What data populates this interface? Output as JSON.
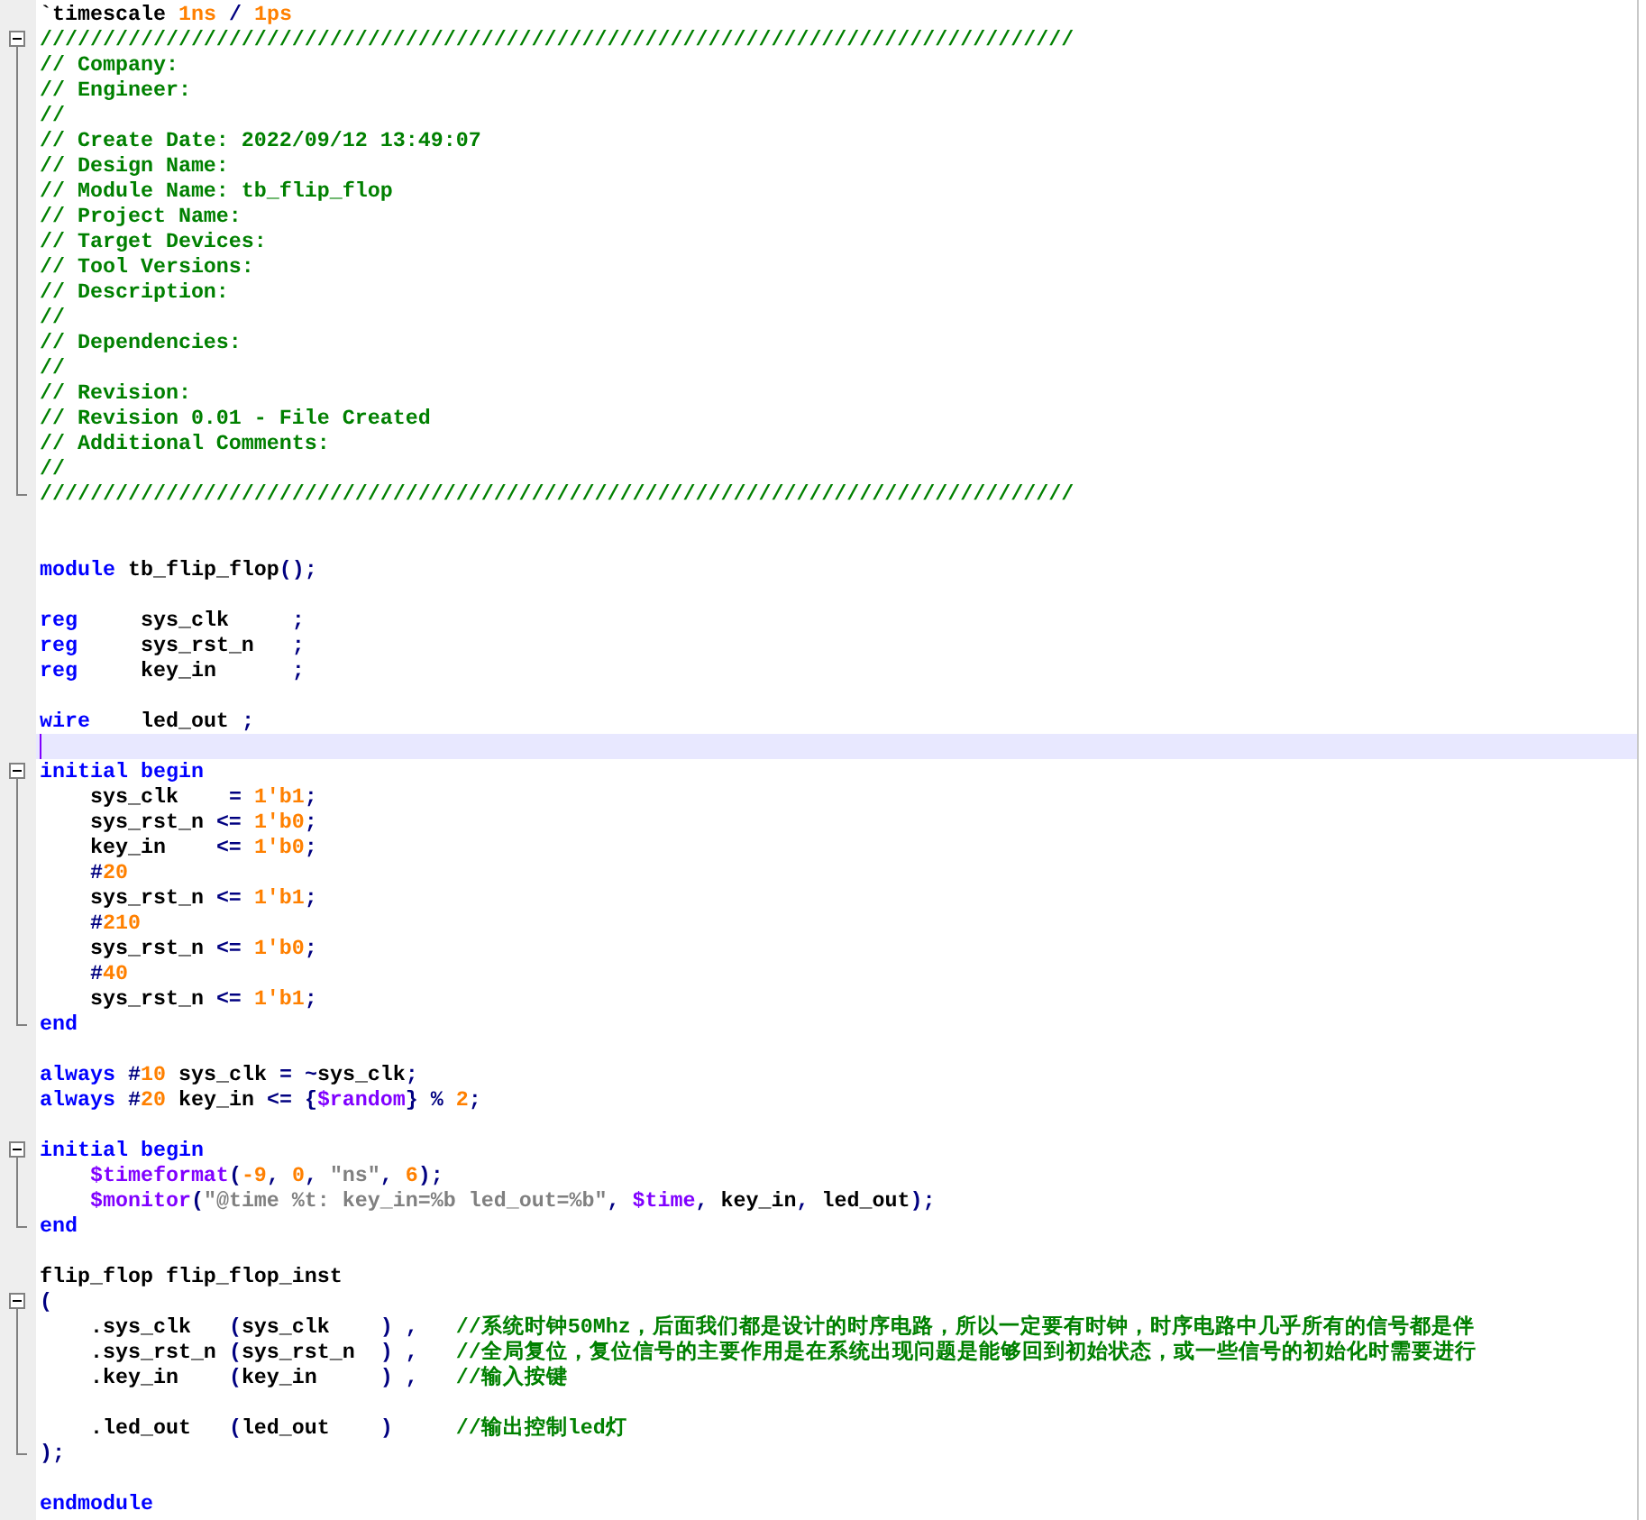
{
  "lines": [
    {
      "kind": "plain",
      "tokens": [
        {
          "kind": "text",
          "text": "`timescale "
        },
        {
          "kind": "number",
          "text": "1ns"
        },
        {
          "kind": "operator",
          "text": " / "
        },
        {
          "kind": "number",
          "text": "1ps"
        }
      ]
    },
    {
      "kind": "opener",
      "expanded": true,
      "tokens": [
        {
          "kind": "comment",
          "text": "//////////////////////////////////////////////////////////////////////////////////"
        }
      ]
    },
    {
      "kind": "body",
      "tokens": [
        {
          "kind": "comment",
          "text": "// Company:"
        }
      ]
    },
    {
      "kind": "body",
      "tokens": [
        {
          "kind": "comment",
          "text": "// Engineer:"
        }
      ]
    },
    {
      "kind": "body",
      "tokens": [
        {
          "kind": "comment",
          "text": "//"
        }
      ]
    },
    {
      "kind": "body",
      "tokens": [
        {
          "kind": "comment",
          "text": "// Create Date: 2022/09/12 13:49:07"
        }
      ]
    },
    {
      "kind": "body",
      "tokens": [
        {
          "kind": "comment",
          "text": "// Design Name:"
        }
      ]
    },
    {
      "kind": "body",
      "tokens": [
        {
          "kind": "comment",
          "text": "// Module Name: tb_flip_flop"
        }
      ]
    },
    {
      "kind": "body",
      "tokens": [
        {
          "kind": "comment",
          "text": "// Project Name:"
        }
      ]
    },
    {
      "kind": "body",
      "tokens": [
        {
          "kind": "comment",
          "text": "// Target Devices:"
        }
      ]
    },
    {
      "kind": "body",
      "tokens": [
        {
          "kind": "comment",
          "text": "// Tool Versions:"
        }
      ]
    },
    {
      "kind": "body",
      "tokens": [
        {
          "kind": "comment",
          "text": "// Description:"
        }
      ]
    },
    {
      "kind": "body",
      "tokens": [
        {
          "kind": "comment",
          "text": "//"
        }
      ]
    },
    {
      "kind": "body",
      "tokens": [
        {
          "kind": "comment",
          "text": "// Dependencies:"
        }
      ]
    },
    {
      "kind": "body",
      "tokens": [
        {
          "kind": "comment",
          "text": "//"
        }
      ]
    },
    {
      "kind": "body",
      "tokens": [
        {
          "kind": "comment",
          "text": "// Revision:"
        }
      ]
    },
    {
      "kind": "body",
      "tokens": [
        {
          "kind": "comment",
          "text": "// Revision 0.01 - File Created"
        }
      ]
    },
    {
      "kind": "body",
      "tokens": [
        {
          "kind": "comment",
          "text": "// Additional Comments:"
        }
      ]
    },
    {
      "kind": "body",
      "tokens": [
        {
          "kind": "comment",
          "text": "//"
        }
      ]
    },
    {
      "kind": "closer",
      "tokens": [
        {
          "kind": "comment",
          "text": "//////////////////////////////////////////////////////////////////////////////////"
        }
      ]
    },
    {
      "kind": "plain"
    },
    {
      "kind": "plain"
    },
    {
      "kind": "plain",
      "tokens": [
        {
          "kind": "keyword",
          "text": "module"
        },
        {
          "kind": "text",
          "text": " tb_flip_flop"
        },
        {
          "kind": "operator",
          "text": "();"
        }
      ]
    },
    {
      "kind": "plain"
    },
    {
      "kind": "plain",
      "tokens": [
        {
          "kind": "keyword",
          "text": "reg"
        },
        {
          "kind": "text",
          "text": "     sys_clk     "
        },
        {
          "kind": "operator",
          "text": ";"
        }
      ]
    },
    {
      "kind": "plain",
      "tokens": [
        {
          "kind": "keyword",
          "text": "reg"
        },
        {
          "kind": "text",
          "text": "     sys_rst_n   "
        },
        {
          "kind": "operator",
          "text": ";"
        }
      ]
    },
    {
      "kind": "plain",
      "tokens": [
        {
          "kind": "keyword",
          "text": "reg"
        },
        {
          "kind": "text",
          "text": "     key_in      "
        },
        {
          "kind": "operator",
          "text": ";"
        }
      ]
    },
    {
      "kind": "plain"
    },
    {
      "kind": "plain",
      "tokens": [
        {
          "kind": "keyword",
          "text": "wire"
        },
        {
          "kind": "text",
          "text": "    led_out "
        },
        {
          "kind": "operator",
          "text": ";"
        }
      ]
    },
    {
      "kind": "plain",
      "current": true
    },
    {
      "kind": "opener",
      "expanded": true,
      "tokens": [
        {
          "kind": "keyword",
          "text": "initial begin"
        }
      ]
    },
    {
      "kind": "body",
      "tokens": [
        {
          "kind": "text",
          "text": "    sys_clk    "
        },
        {
          "kind": "operator",
          "text": "= "
        },
        {
          "kind": "number",
          "text": "1'b1"
        },
        {
          "kind": "operator",
          "text": ";"
        }
      ]
    },
    {
      "kind": "body",
      "tokens": [
        {
          "kind": "text",
          "text": "    sys_rst_n "
        },
        {
          "kind": "operator",
          "text": "<= "
        },
        {
          "kind": "number",
          "text": "1'b0"
        },
        {
          "kind": "operator",
          "text": ";"
        }
      ]
    },
    {
      "kind": "body",
      "tokens": [
        {
          "kind": "text",
          "text": "    key_in    "
        },
        {
          "kind": "operator",
          "text": "<= "
        },
        {
          "kind": "number",
          "text": "1'b0"
        },
        {
          "kind": "operator",
          "text": ";"
        }
      ]
    },
    {
      "kind": "body",
      "tokens": [
        {
          "kind": "operator",
          "text": "    #"
        },
        {
          "kind": "number",
          "text": "20"
        }
      ]
    },
    {
      "kind": "body",
      "tokens": [
        {
          "kind": "text",
          "text": "    sys_rst_n "
        },
        {
          "kind": "operator",
          "text": "<= "
        },
        {
          "kind": "number",
          "text": "1'b1"
        },
        {
          "kind": "operator",
          "text": ";"
        }
      ]
    },
    {
      "kind": "body",
      "tokens": [
        {
          "kind": "operator",
          "text": "    #"
        },
        {
          "kind": "number",
          "text": "210"
        }
      ]
    },
    {
      "kind": "body",
      "tokens": [
        {
          "kind": "text",
          "text": "    sys_rst_n "
        },
        {
          "kind": "operator",
          "text": "<= "
        },
        {
          "kind": "number",
          "text": "1'b0"
        },
        {
          "kind": "operator",
          "text": ";"
        }
      ]
    },
    {
      "kind": "body",
      "tokens": [
        {
          "kind": "operator",
          "text": "    #"
        },
        {
          "kind": "number",
          "text": "40"
        }
      ]
    },
    {
      "kind": "body",
      "tokens": [
        {
          "kind": "text",
          "text": "    sys_rst_n "
        },
        {
          "kind": "operator",
          "text": "<= "
        },
        {
          "kind": "number",
          "text": "1'b1"
        },
        {
          "kind": "operator",
          "text": ";"
        }
      ]
    },
    {
      "kind": "closer",
      "tokens": [
        {
          "kind": "keyword",
          "text": "end"
        }
      ]
    },
    {
      "kind": "plain"
    },
    {
      "kind": "plain",
      "tokens": [
        {
          "kind": "keyword",
          "text": "always"
        },
        {
          "kind": "operator",
          "text": " #"
        },
        {
          "kind": "number",
          "text": "10"
        },
        {
          "kind": "text",
          "text": " sys_clk "
        },
        {
          "kind": "operator",
          "text": "= ~"
        },
        {
          "kind": "text",
          "text": "sys_clk"
        },
        {
          "kind": "operator",
          "text": ";"
        }
      ]
    },
    {
      "kind": "plain",
      "tokens": [
        {
          "kind": "keyword",
          "text": "always"
        },
        {
          "kind": "operator",
          "text": " #"
        },
        {
          "kind": "number",
          "text": "20"
        },
        {
          "kind": "text",
          "text": " key_in "
        },
        {
          "kind": "operator",
          "text": "<= {"
        },
        {
          "kind": "system",
          "text": "$random"
        },
        {
          "kind": "operator",
          "text": "} % "
        },
        {
          "kind": "number",
          "text": "2"
        },
        {
          "kind": "operator",
          "text": ";"
        }
      ]
    },
    {
      "kind": "plain"
    },
    {
      "kind": "opener",
      "expanded": true,
      "tokens": [
        {
          "kind": "keyword",
          "text": "initial begin"
        }
      ]
    },
    {
      "kind": "body",
      "tokens": [
        {
          "kind": "system",
          "text": "    $timeformat"
        },
        {
          "kind": "operator",
          "text": "("
        },
        {
          "kind": "number",
          "text": "-9"
        },
        {
          "kind": "operator",
          "text": ", "
        },
        {
          "kind": "number",
          "text": "0"
        },
        {
          "kind": "operator",
          "text": ", "
        },
        {
          "kind": "string",
          "text": "\"ns\""
        },
        {
          "kind": "operator",
          "text": ", "
        },
        {
          "kind": "number",
          "text": "6"
        },
        {
          "kind": "operator",
          "text": ");"
        }
      ]
    },
    {
      "kind": "body",
      "tokens": [
        {
          "kind": "system",
          "text": "    $monitor"
        },
        {
          "kind": "operator",
          "text": "("
        },
        {
          "kind": "string",
          "text": "\"@time %t: key_in=%b led_out=%b\""
        },
        {
          "kind": "operator",
          "text": ", "
        },
        {
          "kind": "system",
          "text": "$time"
        },
        {
          "kind": "operator",
          "text": ","
        },
        {
          "kind": "text",
          "text": " key_in"
        },
        {
          "kind": "operator",
          "text": ","
        },
        {
          "kind": "text",
          "text": " led_out"
        },
        {
          "kind": "operator",
          "text": ");"
        }
      ]
    },
    {
      "kind": "closer",
      "tokens": [
        {
          "kind": "keyword",
          "text": "end"
        }
      ]
    },
    {
      "kind": "plain"
    },
    {
      "kind": "plain",
      "tokens": [
        {
          "kind": "text",
          "text": "flip_flop flip_flop_inst"
        }
      ]
    },
    {
      "kind": "opener",
      "expanded": true,
      "tokens": [
        {
          "kind": "operator",
          "text": "("
        }
      ]
    },
    {
      "kind": "body",
      "tokens": [
        {
          "kind": "text",
          "text": "    .sys_clk   "
        },
        {
          "kind": "operator",
          "text": "("
        },
        {
          "kind": "text",
          "text": "sys_clk    "
        },
        {
          "kind": "operator",
          "text": ") ,"
        },
        {
          "kind": "comment",
          "text": "   //系统时钟50Mhz，后面我们都是设计的时序电路，所以一定要有时钟，时序电路中几乎所有的信号都是伴"
        }
      ]
    },
    {
      "kind": "body",
      "tokens": [
        {
          "kind": "text",
          "text": "    .sys_rst_n "
        },
        {
          "kind": "operator",
          "text": "("
        },
        {
          "kind": "text",
          "text": "sys_rst_n  "
        },
        {
          "kind": "operator",
          "text": ") ,"
        },
        {
          "kind": "comment",
          "text": "   //全局复位，复位信号的主要作用是在系统出现问题是能够回到初始状态，或一些信号的初始化时需要进行"
        }
      ]
    },
    {
      "kind": "body",
      "tokens": [
        {
          "kind": "text",
          "text": "    .key_in    "
        },
        {
          "kind": "operator",
          "text": "("
        },
        {
          "kind": "text",
          "text": "key_in     "
        },
        {
          "kind": "operator",
          "text": ") ,"
        },
        {
          "kind": "comment",
          "text": "   //输入按键"
        }
      ]
    },
    {
      "kind": "body"
    },
    {
      "kind": "body",
      "tokens": [
        {
          "kind": "text",
          "text": "    .led_out   "
        },
        {
          "kind": "operator",
          "text": "("
        },
        {
          "kind": "text",
          "text": "led_out    "
        },
        {
          "kind": "operator",
          "text": ")"
        },
        {
          "kind": "comment",
          "text": "     //输出控制led灯"
        }
      ]
    },
    {
      "kind": "closer",
      "tokens": [
        {
          "kind": "operator",
          "text": ");"
        }
      ]
    },
    {
      "kind": "plain"
    },
    {
      "kind": "plain",
      "tokens": [
        {
          "kind": "keyword",
          "text": "endmodule"
        }
      ]
    }
  ]
}
